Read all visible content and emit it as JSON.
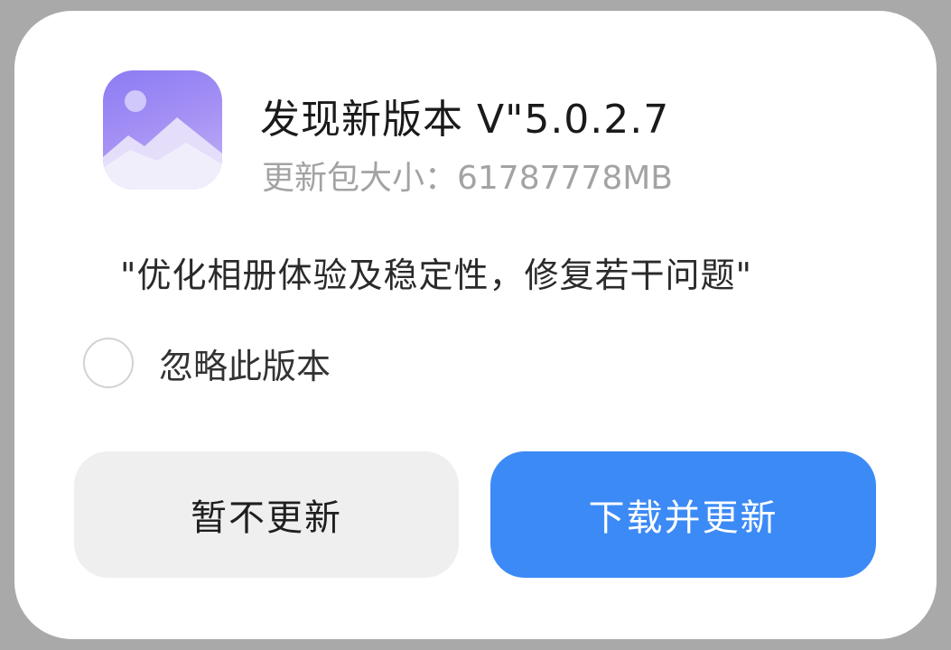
{
  "dialog": {
    "app_icon": "gallery-icon",
    "title": "发现新版本 V\"5.0.2.7",
    "package_size": "更新包大小：61787778MB",
    "release_notes": "\"优化相册体验及稳定性，修复若干问题\"",
    "ignore_version": {
      "label": "忽略此版本",
      "checked": false
    },
    "buttons": {
      "later_label": "暂不更新",
      "update_label": "下载并更新"
    }
  },
  "colors": {
    "primary": "#3c8af5",
    "secondary_button_bg": "#efefef",
    "subtitle_text": "#a3a3a3"
  }
}
